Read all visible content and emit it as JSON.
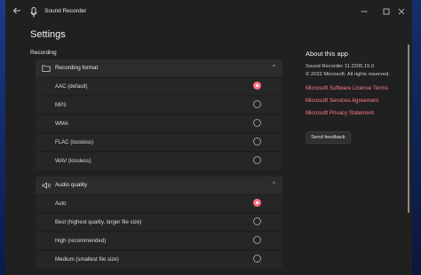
{
  "titlebar": {
    "app_title": "Sound Recorder"
  },
  "page": {
    "title": "Settings",
    "section": "Recording"
  },
  "recording_format": {
    "header": "Recording format",
    "options": [
      {
        "label": "AAC (default)",
        "selected": true
      },
      {
        "label": "MP3",
        "selected": false
      },
      {
        "label": "WMA",
        "selected": false
      },
      {
        "label": "FLAC (lossless)",
        "selected": false
      },
      {
        "label": "WAV (lossless)",
        "selected": false
      }
    ]
  },
  "audio_quality": {
    "header": "Audio quality",
    "options": [
      {
        "label": "Auto",
        "selected": true
      },
      {
        "label": "Best (highest quality, larger file size)",
        "selected": false
      },
      {
        "label": "High (recommended)",
        "selected": false
      },
      {
        "label": "Medium (smallest file size)",
        "selected": false
      }
    ]
  },
  "about": {
    "title": "About this app",
    "version": "Sound Recorder 11.2205.15.0",
    "copyright": "© 2022 Microsoft. All rights reserved.",
    "links": [
      "Microsoft Software License Terms",
      "Microsoft Services Agreement",
      "Microsoft Privacy Statement"
    ],
    "feedback": "Send feedback"
  },
  "colors": {
    "accent": "#ff6f80",
    "link": "#ff7a8a",
    "background": "#202020",
    "card": "#2c2c2c"
  }
}
